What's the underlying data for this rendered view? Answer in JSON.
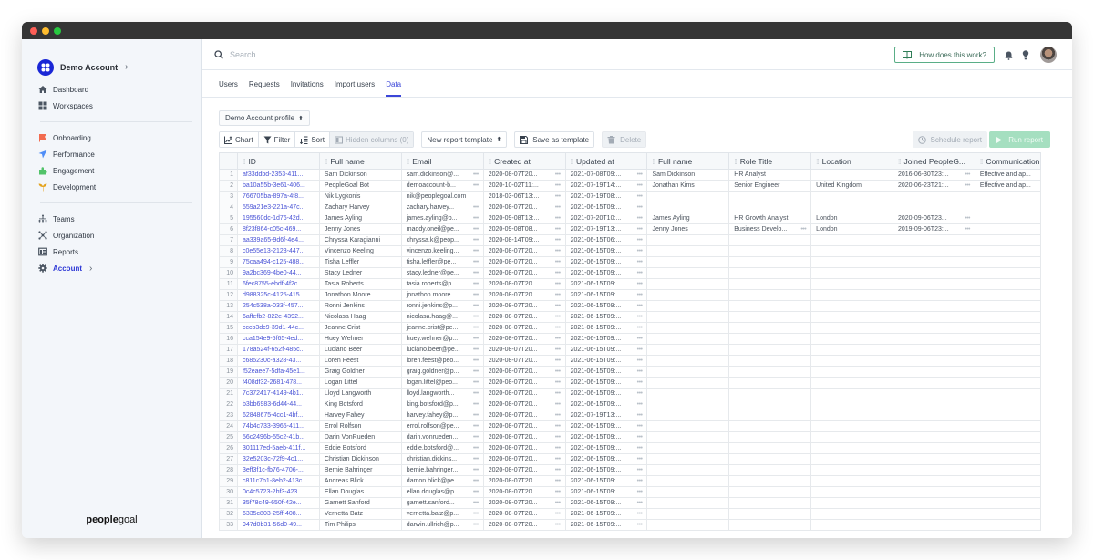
{
  "window": {
    "title": ""
  },
  "sidebar": {
    "account_name": "Demo Account",
    "nav_primary": [
      {
        "label": "Dashboard",
        "icon": "home-icon"
      },
      {
        "label": "Workspaces",
        "icon": "grid-icon"
      }
    ],
    "nav_modules": [
      {
        "label": "Onboarding",
        "icon": "flag-icon",
        "color": "#f26b4f"
      },
      {
        "label": "Performance",
        "icon": "paper-plane-icon",
        "color": "#4f8ef7"
      },
      {
        "label": "Engagement",
        "icon": "puzzle-icon",
        "color": "#52c36a"
      },
      {
        "label": "Development",
        "icon": "sprout-icon",
        "color": "#e4a31d"
      }
    ],
    "nav_admin": [
      {
        "label": "Teams",
        "icon": "teams-icon"
      },
      {
        "label": "Organization",
        "icon": "organization-icon"
      },
      {
        "label": "Reports",
        "icon": "reports-icon"
      },
      {
        "label": "Account",
        "icon": "gear-icon",
        "active": true
      }
    ],
    "brand_bold": "people",
    "brand_light": "goal"
  },
  "topbar": {
    "search_placeholder": "Search",
    "help_label": "How does this work?"
  },
  "tabs": [
    {
      "label": "Users"
    },
    {
      "label": "Requests"
    },
    {
      "label": "Invitations"
    },
    {
      "label": "Import users"
    },
    {
      "label": "Data",
      "active": true
    }
  ],
  "toolbar": {
    "profile_select": "Demo Account profile",
    "chart": "Chart",
    "filter": "Filter",
    "sort": "Sort",
    "hidden_columns": "Hidden columns (0)",
    "report_template": "New report template",
    "save_template": "Save as template",
    "delete": "Delete",
    "schedule": "Schedule report",
    "run": "Run report"
  },
  "table": {
    "columns": [
      "ID",
      "Full name",
      "Email",
      "Created at",
      "Updated at",
      "Full name",
      "Role Title",
      "Location",
      "Joined PeopleG...",
      "Communication"
    ],
    "rows": [
      [
        "af33ddbd-2353-411...",
        "Sam Dickinson",
        "sam.dickinson@...",
        "2020-08-07T20...",
        "2021-07-08T09:...",
        "Sam Dickinson",
        "HR Analyst",
        "",
        "2016-06-30T23:...",
        "Effective and ap..."
      ],
      [
        "ba10a55b-3e61-406...",
        "PeopleGoal Bot",
        "demoaccount-b...",
        "2020-10-02T11:...",
        "2021-07-19T14:...",
        "Jonathan Kims",
        "Senior Engineer",
        "United Kingdom",
        "2020-06-23T21:...",
        "Effective and ap..."
      ],
      [
        "766705ba-897a-4f8...",
        "Nik Lygkonis",
        "nik@peoplegoal.com",
        "2018-03-06T13:...",
        "2021-07-19T08:...",
        "",
        "",
        "",
        "",
        ""
      ],
      [
        "559a21e3-221a-47c...",
        "Zachary Harvey",
        "zachary.harvey...",
        "2020-08-07T20...",
        "2021-06-15T09:...",
        "",
        "",
        "",
        "",
        ""
      ],
      [
        "195560dc-1d76-42d...",
        "James Ayling",
        "james.ayling@p...",
        "2020-09-08T13:...",
        "2021-07-20T10:...",
        "James Ayling",
        "HR Growth Analyst",
        "London",
        "2020-09-06T23...",
        ""
      ],
      [
        "8f23f864-c05c-469...",
        "Jenny Jones",
        "maddy.oneil@pe...",
        "2020-09-08T08...",
        "2021-07-19T13:...",
        "Jenny Jones",
        "Business Develo...",
        "London",
        "2019-09-06T23:...",
        ""
      ],
      [
        "aa339a65-9d6f-4e4...",
        "Chryssa Karagianni",
        "chryssa.k@peop...",
        "2020-08-14T09:...",
        "2021-06-15T06:...",
        "",
        "",
        "",
        "",
        ""
      ],
      [
        "c0e55e13-2123-447...",
        "Vincenzo Keeling",
        "vincenzo.keeling...",
        "2020-08-07T20...",
        "2021-06-15T09:...",
        "",
        "",
        "",
        "",
        ""
      ],
      [
        "75caa494-c125-488...",
        "Tisha Leffler",
        "tisha.leffler@pe...",
        "2020-08-07T20...",
        "2021-06-15T09:...",
        "",
        "",
        "",
        "",
        ""
      ],
      [
        "9a2bc369-4be0-44...",
        "Stacy Ledner",
        "stacy.ledner@pe...",
        "2020-08-07T20...",
        "2021-06-15T09:...",
        "",
        "",
        "",
        "",
        ""
      ],
      [
        "6fec8755-ebdf-4f2c...",
        "Tasia Roberts",
        "tasia.roberts@p...",
        "2020-08-07T20...",
        "2021-06-15T09:...",
        "",
        "",
        "",
        "",
        ""
      ],
      [
        "d988325c-4125-415...",
        "Jonathon Moore",
        "jonathon.moore...",
        "2020-08-07T20...",
        "2021-06-15T09:...",
        "",
        "",
        "",
        "",
        ""
      ],
      [
        "254c538a-033f-457...",
        "Ronni Jenkins",
        "ronni.jenkins@p...",
        "2020-08-07T20...",
        "2021-06-15T09:...",
        "",
        "",
        "",
        "",
        ""
      ],
      [
        "6affefb2-822e-4392...",
        "Nicolasa Haag",
        "nicolasa.haag@...",
        "2020-08-07T20...",
        "2021-06-15T09:...",
        "",
        "",
        "",
        "",
        ""
      ],
      [
        "cccb3dc9-39d1-44c...",
        "Jeanne Crist",
        "jeanne.crist@pe...",
        "2020-08-07T20...",
        "2021-06-15T09:...",
        "",
        "",
        "",
        "",
        ""
      ],
      [
        "cca154e9-5f65-4ed...",
        "Huey Wehner",
        "huey.wehner@p...",
        "2020-08-07T20...",
        "2021-06-15T09:...",
        "",
        "",
        "",
        "",
        ""
      ],
      [
        "178a524f-652f-485c...",
        "Luciano Beer",
        "luciano.beer@pe...",
        "2020-08-07T20...",
        "2021-06-15T09:...",
        "",
        "",
        "",
        "",
        ""
      ],
      [
        "c685230c-a328-43...",
        "Loren Feest",
        "loren.feest@peo...",
        "2020-08-07T20...",
        "2021-06-15T09:...",
        "",
        "",
        "",
        "",
        ""
      ],
      [
        "f52eaee7-5dfa-45e1...",
        "Graig Goldner",
        "graig.goldner@p...",
        "2020-08-07T20...",
        "2021-06-15T09:...",
        "",
        "",
        "",
        "",
        ""
      ],
      [
        "f408df32-2681-478...",
        "Logan Littel",
        "logan.littel@peo...",
        "2020-08-07T20...",
        "2021-06-15T09:...",
        "",
        "",
        "",
        "",
        ""
      ],
      [
        "7c372417-4149-4b1...",
        "Lloyd Langworth",
        "lloyd.langworth...",
        "2020-08-07T20...",
        "2021-06-15T09:...",
        "",
        "",
        "",
        "",
        ""
      ],
      [
        "b3bb6983-6d44-44...",
        "King Botsford",
        "king.botsford@p...",
        "2020-08-07T20...",
        "2021-06-15T09:...",
        "",
        "",
        "",
        "",
        ""
      ],
      [
        "62848675-4cc1-4bf...",
        "Harvey Fahey",
        "harvey.fahey@p...",
        "2020-08-07T20...",
        "2021-07-19T13:...",
        "",
        "",
        "",
        "",
        ""
      ],
      [
        "74b4c733-3965-411...",
        "Errol Rolfson",
        "errol.rolfson@pe...",
        "2020-08-07T20...",
        "2021-06-15T09:...",
        "",
        "",
        "",
        "",
        ""
      ],
      [
        "56c2496b-55c2-41b...",
        "Darin VonRueden",
        "darin.vonrueden...",
        "2020-08-07T20...",
        "2021-06-15T09:...",
        "",
        "",
        "",
        "",
        ""
      ],
      [
        "301117ed-5aeb-411f...",
        "Eddie Botsford",
        "eddie.botsford@...",
        "2020-08-07T20...",
        "2021-06-15T09:...",
        "",
        "",
        "",
        "",
        ""
      ],
      [
        "32e5203c-72f9-4c1...",
        "Christian Dickinson",
        "christian.dickins...",
        "2020-08-07T20...",
        "2021-06-15T09:...",
        "",
        "",
        "",
        "",
        ""
      ],
      [
        "3eff3f1c-fb76-4706-...",
        "Bernie Bahringer",
        "bernie.bahringer...",
        "2020-08-07T20...",
        "2021-06-15T09:...",
        "",
        "",
        "",
        "",
        ""
      ],
      [
        "c811c7b1-8eb2-413c...",
        "Andreas Blick",
        "damon.blick@pe...",
        "2020-08-07T20...",
        "2021-06-15T09:...",
        "",
        "",
        "",
        "",
        ""
      ],
      [
        "0c4c5723-2bf3-423...",
        "Ellan Douglas",
        "ellan.douglas@p...",
        "2020-08-07T20...",
        "2021-06-15T09:...",
        "",
        "",
        "",
        "",
        ""
      ],
      [
        "35f78c49-650f-42e...",
        "Garnett Sanford",
        "garnett.sanford...",
        "2020-08-07T20...",
        "2021-06-15T09:...",
        "",
        "",
        "",
        "",
        ""
      ],
      [
        "6335c803-25ff-408...",
        "Vernetta Batz",
        "vernetta.batz@p...",
        "2020-08-07T20...",
        "2021-06-15T09:...",
        "",
        "",
        "",
        "",
        ""
      ],
      [
        "947d0b31-56d0-49...",
        "Tim Philips",
        "darwin.ullrich@p...",
        "2020-08-07T20...",
        "2021-06-15T09:...",
        "",
        "",
        "",
        "",
        ""
      ]
    ]
  }
}
